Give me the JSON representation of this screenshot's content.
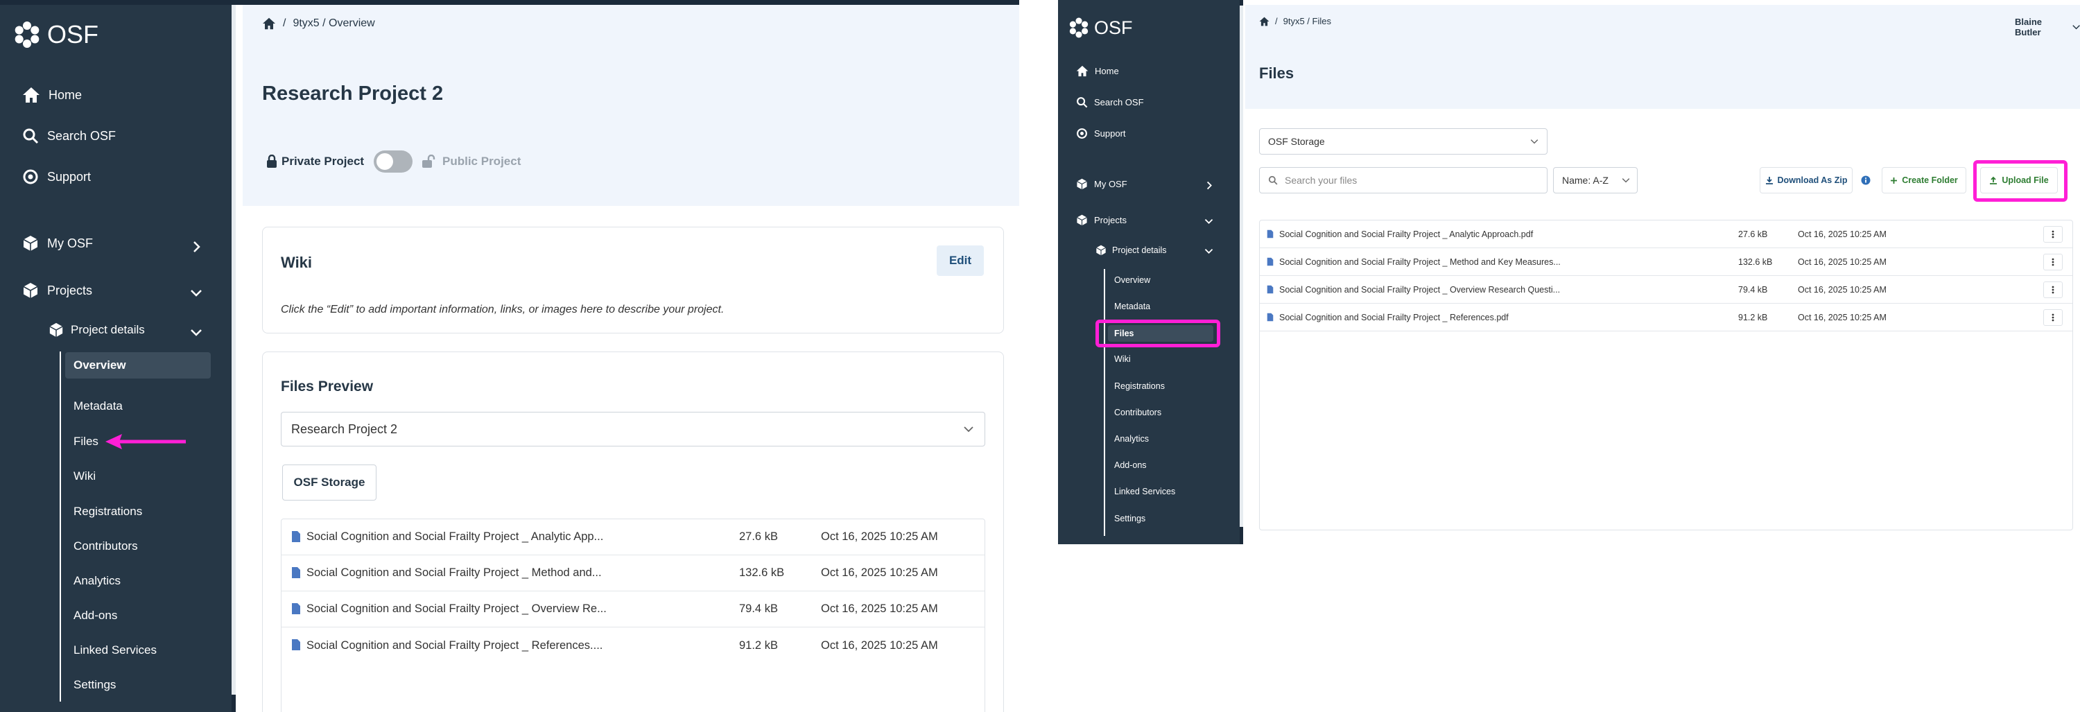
{
  "left": {
    "logo_text": "OSF",
    "nav": {
      "home": "Home",
      "search": "Search OSF",
      "support": "Support",
      "my_osf": "My OSF",
      "projects": "Projects",
      "project_details": "Project details",
      "sub_items": [
        "Overview",
        "Metadata",
        "Files",
        "Wiki",
        "Registrations",
        "Contributors",
        "Analytics",
        "Add-ons",
        "Linked Services",
        "Settings"
      ],
      "active_item": "Overview"
    },
    "breadcrumb": {
      "sep": "/",
      "path": "9tyx5 / Overview"
    },
    "page_title": "Research Project 2",
    "privacy": {
      "private_label": "Private Project",
      "public_label": "Public Project"
    },
    "wiki": {
      "title": "Wiki",
      "edit_label": "Edit",
      "body": "Click the “Edit” to add important information, links, or images here to describe your project."
    },
    "files_preview": {
      "title": "Files Preview",
      "project_select": "Research Project 2",
      "storage_button": "OSF Storage",
      "rows": [
        {
          "name": "Social Cognition and Social Frailty Project _ Analytic App...",
          "size": "27.6 kB",
          "date": "Oct 16, 2025 10:25 AM"
        },
        {
          "name": "Social Cognition and Social Frailty Project _ Method and...",
          "size": "132.6 kB",
          "date": "Oct 16, 2025 10:25 AM"
        },
        {
          "name": "Social Cognition and Social Frailty Project _ Overview Re...",
          "size": "79.4 kB",
          "date": "Oct 16, 2025 10:25 AM"
        },
        {
          "name": "Social Cognition and Social Frailty Project _ References....",
          "size": "91.2 kB",
          "date": "Oct 16, 2025 10:25 AM"
        }
      ]
    }
  },
  "right": {
    "logo_text": "OSF",
    "user_name": "Blaine Butler",
    "nav": {
      "home": "Home",
      "search": "Search OSF",
      "support": "Support",
      "my_osf": "My OSF",
      "projects": "Projects",
      "project_details": "Project details",
      "sub_items": [
        "Overview",
        "Metadata",
        "Files",
        "Wiki",
        "Registrations",
        "Contributors",
        "Analytics",
        "Add-ons",
        "Linked Services",
        "Settings"
      ],
      "active_item": "Files"
    },
    "breadcrumb": {
      "sep": "/",
      "path": "9tyx5 / Files"
    },
    "page_title": "Files",
    "storage_select": "OSF Storage",
    "search_placeholder": "Search your files",
    "sort_select": "Name: A-Z",
    "download_zip": "Download As Zip",
    "create_folder": "Create Folder",
    "upload_file": "Upload File",
    "rows": [
      {
        "name": "Social Cognition and Social Frailty Project _ Analytic Approach.pdf",
        "size": "27.6 kB",
        "date": "Oct 16, 2025 10:25 AM"
      },
      {
        "name": "Social Cognition and Social Frailty Project _ Method and Key Measures...",
        "size": "132.6 kB",
        "date": "Oct 16, 2025 10:25 AM"
      },
      {
        "name": "Social Cognition and Social Frailty Project _ Overview Research Questi...",
        "size": "79.4 kB",
        "date": "Oct 16, 2025 10:25 AM"
      },
      {
        "name": "Social Cognition and Social Frailty Project _ References.pdf",
        "size": "91.2 kB",
        "date": "Oct 16, 2025 10:25 AM"
      }
    ]
  },
  "colors": {
    "sidebar": "#263746",
    "header_bg": "#f0f5fc",
    "annotation": "#ff1fd6",
    "link_blue": "#1f4f7a",
    "green": "#2e7d32"
  },
  "icons": [
    "osf-logo-icon",
    "home-icon",
    "search-icon",
    "support-icon",
    "cube-icon",
    "chevron-right-icon",
    "chevron-down-icon",
    "lock-icon",
    "unlock-icon",
    "file-icon",
    "download-icon",
    "info-icon",
    "plus-icon",
    "upload-icon",
    "kebab-icon"
  ]
}
